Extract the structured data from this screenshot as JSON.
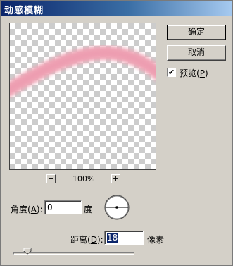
{
  "dialog": {
    "title": "动感模糊"
  },
  "preview": {
    "zoom": "100%",
    "zoom_out_label": "−",
    "zoom_in_label": "+"
  },
  "buttons": {
    "ok": "确定",
    "cancel": "取消"
  },
  "preview_checkbox": {
    "label": "预览",
    "shortcut": "P",
    "checked": true,
    "check_mark": "✔"
  },
  "angle": {
    "label": "角度",
    "shortcut": "A",
    "value": "0",
    "unit": "度"
  },
  "distance": {
    "label": "距离",
    "shortcut": "D",
    "value": "18",
    "unit": "像素",
    "slider_level_percent": 9
  },
  "colors": {
    "accent": "#0a246a",
    "stroke": "#f0a8b8",
    "background": "#d4d0c8"
  }
}
